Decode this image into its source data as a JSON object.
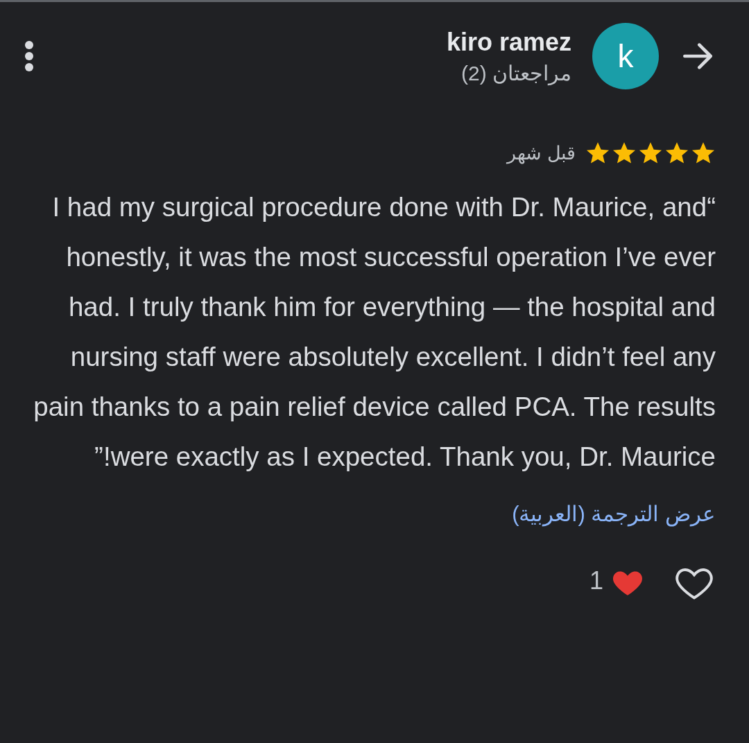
{
  "review": {
    "author": {
      "name": "kiro ramez",
      "initial": "k",
      "reviews_count": "مراجعتان (2)"
    },
    "stars": 5,
    "time": "قبل شهر",
    "text": "“I had my surgical procedure done with Dr. Maurice, and honestly, it was the most successful operation I’ve ever had. I truly thank him for everything — the hospital and nursing staff were absolutely excellent. I didn’t feel any pain thanks to a pain relief device called PCA. The results were exactly as I expected. Thank you, Dr. Maurice!”",
    "translate_link": "عرض الترجمة (العربية)",
    "reaction_count": "1",
    "like_button": {
      "selected": false
    }
  }
}
